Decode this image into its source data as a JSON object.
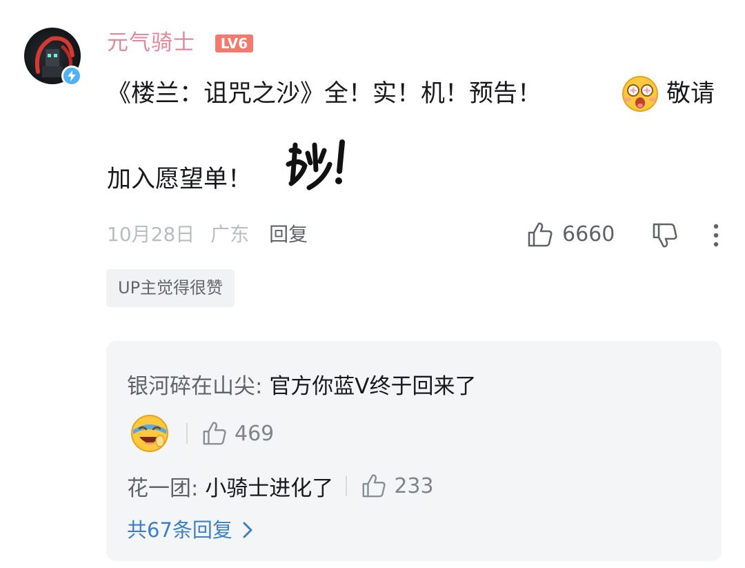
{
  "comment": {
    "username": "元气骑士",
    "level": "LV6",
    "text_line1": "《楼兰：诅咒之沙》全！实！机！预告！",
    "text_line1_tail": "敬请",
    "text_line2": "加入愿望单！",
    "date": "10月28日",
    "location": "广东",
    "reply_label": "回复",
    "like_count": "6660",
    "up_tag": "UP主觉得很赞"
  },
  "replies": [
    {
      "name": "银河碎在山尖",
      "text": "官方你蓝V终于回来了",
      "like_count": "469"
    },
    {
      "name": "花一团",
      "text": "小骑士进化了",
      "like_count": "233"
    }
  ],
  "view_more": "共67条回复",
  "colors": {
    "username": "#e5879b",
    "level_badge": "#f27a6f",
    "link_blue": "#3c7fc4",
    "verified_blue": "#4fb2f2"
  },
  "icons": [
    "verified-badge-icon",
    "thumbs-up-icon",
    "thumbs-down-icon",
    "more-vertical-icon",
    "chevron-right-icon",
    "starry-eyes-emoji-icon",
    "laughing-emoji-icon",
    "miao-sticker-icon"
  ]
}
